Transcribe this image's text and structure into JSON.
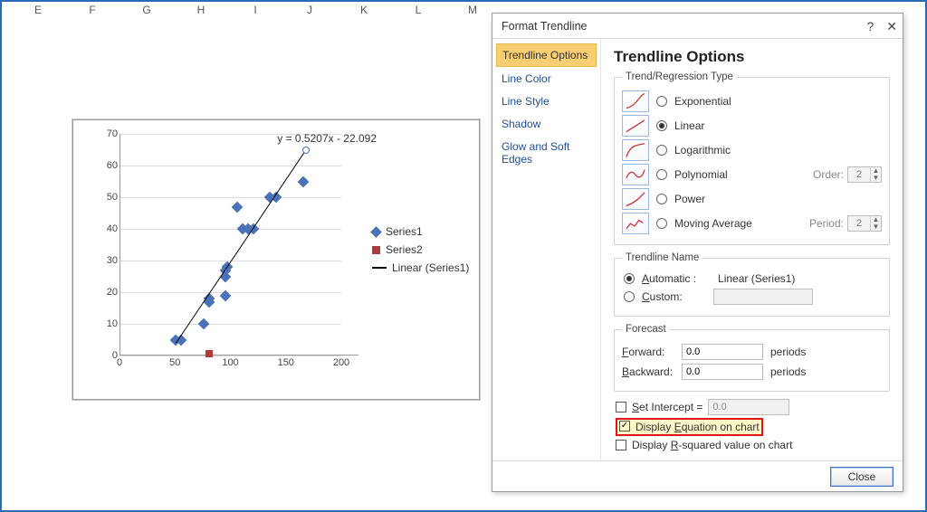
{
  "spreadsheet": {
    "columns": [
      "E",
      "F",
      "G",
      "H",
      "I",
      "J",
      "K",
      "L",
      "M"
    ]
  },
  "chart_data": {
    "type": "scatter",
    "title": "",
    "xlabel": "",
    "ylabel": "",
    "xlim": [
      0,
      200
    ],
    "ylim": [
      0,
      70
    ],
    "xticks": [
      0,
      50,
      100,
      150,
      200
    ],
    "yticks": [
      0,
      10,
      20,
      30,
      40,
      50,
      60,
      70
    ],
    "series": [
      {
        "name": "Series1",
        "marker": "diamond",
        "color": "#4a72b8",
        "points": [
          {
            "x": 50,
            "y": 5
          },
          {
            "x": 55,
            "y": 5
          },
          {
            "x": 75,
            "y": 10
          },
          {
            "x": 80,
            "y": 18
          },
          {
            "x": 80,
            "y": 17
          },
          {
            "x": 95,
            "y": 19
          },
          {
            "x": 95,
            "y": 25
          },
          {
            "x": 95,
            "y": 27
          },
          {
            "x": 96,
            "y": 28
          },
          {
            "x": 105,
            "y": 47
          },
          {
            "x": 110,
            "y": 40
          },
          {
            "x": 115,
            "y": 40
          },
          {
            "x": 120,
            "y": 40
          },
          {
            "x": 135,
            "y": 50
          },
          {
            "x": 140,
            "y": 50
          },
          {
            "x": 165,
            "y": 55
          }
        ]
      },
      {
        "name": "Series2",
        "marker": "square",
        "color": "#b33a3a",
        "points": [
          {
            "x": 80,
            "y": 0.5
          }
        ]
      }
    ],
    "trendline": {
      "name": "Linear (Series1)",
      "equation": "y = 0.5207x - 22.092",
      "x_range": [
        50,
        167
      ],
      "slope": 0.5207,
      "intercept": -22.092
    },
    "legend": {
      "items": [
        "Series1",
        "Series2",
        "Linear (Series1)"
      ]
    }
  },
  "dialog": {
    "title": "Format Trendline",
    "nav": [
      "Trendline Options",
      "Line Color",
      "Line Style",
      "Shadow",
      "Glow and Soft Edges"
    ],
    "selected_nav": 0,
    "pane_title": "Trendline Options",
    "type_group_label": "Trend/Regression Type",
    "types": {
      "exponential": "Exponential",
      "linear": "Linear",
      "logarithmic": "Logarithmic",
      "polynomial": "Polynomial",
      "power": "Power",
      "moving_average": "Moving Average"
    },
    "selected_type": "linear",
    "order_label": "Order:",
    "order_value": "2",
    "period_label": "Period:",
    "period_value": "2",
    "name_group_label": "Trendline Name",
    "name_auto_label": "Automatic :",
    "name_auto_value": "Linear (Series1)",
    "name_custom_label": "Custom:",
    "name_custom_value": "",
    "name_selected": "automatic",
    "forecast_group_label": "Forecast",
    "forecast_forward_label": "Forward:",
    "forecast_forward_value": "0.0",
    "forecast_backward_label": "Backward:",
    "forecast_backward_value": "0.0",
    "forecast_unit": "periods",
    "set_intercept_label": "Set Intercept =",
    "set_intercept_checked": false,
    "set_intercept_value": "0.0",
    "display_eq_label": "Display Equation on chart",
    "display_eq_checked": true,
    "display_r2_label": "Display R-squared value on chart",
    "display_r2_checked": false,
    "close_label": "Close"
  }
}
